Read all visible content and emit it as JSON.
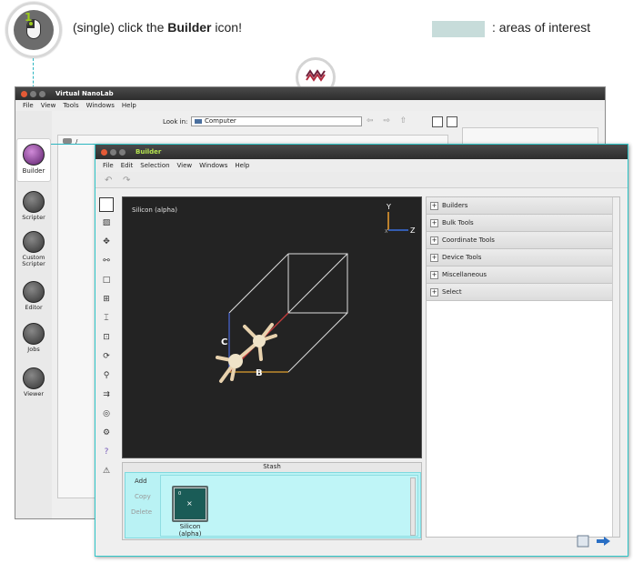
{
  "tutorial": {
    "step_number": "1",
    "instruction_prefix": "(single) click the ",
    "instruction_bold": "Builder",
    "instruction_suffix": " icon!",
    "legend_text": ": areas of interest",
    "highlight_color": "#2bb5c0",
    "legend_color": "#c7dcda"
  },
  "main_window": {
    "title": "Virtual NanoLab",
    "menu": [
      "File",
      "View",
      "Tools",
      "Windows",
      "Help"
    ],
    "sidebar": [
      {
        "label": "Builder",
        "icon": "builder-icon"
      },
      {
        "label": "Scripter",
        "icon": "scripter-icon"
      },
      {
        "label": "Custom Scripter",
        "icon": "custom-scripter-icon"
      },
      {
        "label": "Editor",
        "icon": "editor-icon"
      },
      {
        "label": "Jobs",
        "icon": "jobs-icon"
      },
      {
        "label": "Viewer",
        "icon": "viewer-icon"
      }
    ],
    "look_in_label": "Look in:",
    "look_in_value": "Computer",
    "path": "/"
  },
  "builder_window": {
    "title": "Builder",
    "menu": [
      "File",
      "Edit",
      "Selection",
      "View",
      "Windows",
      "Help"
    ],
    "viewport": {
      "structure_label": "Silicon (alpha)",
      "axis_labels": {
        "y": "Y",
        "z": "Z",
        "x": "X"
      },
      "lattice_labels": {
        "c": "C",
        "b": "B"
      }
    },
    "stash": {
      "title": "Stash",
      "buttons": [
        "Add",
        "Copy",
        "Delete"
      ],
      "item_index": "0",
      "item_label_line1": "Silicon",
      "item_label_line2": "(alpha)"
    },
    "panels": [
      "Builders",
      "Bulk Tools",
      "Coordinate Tools",
      "Device Tools",
      "Miscellaneous",
      "Select"
    ]
  }
}
